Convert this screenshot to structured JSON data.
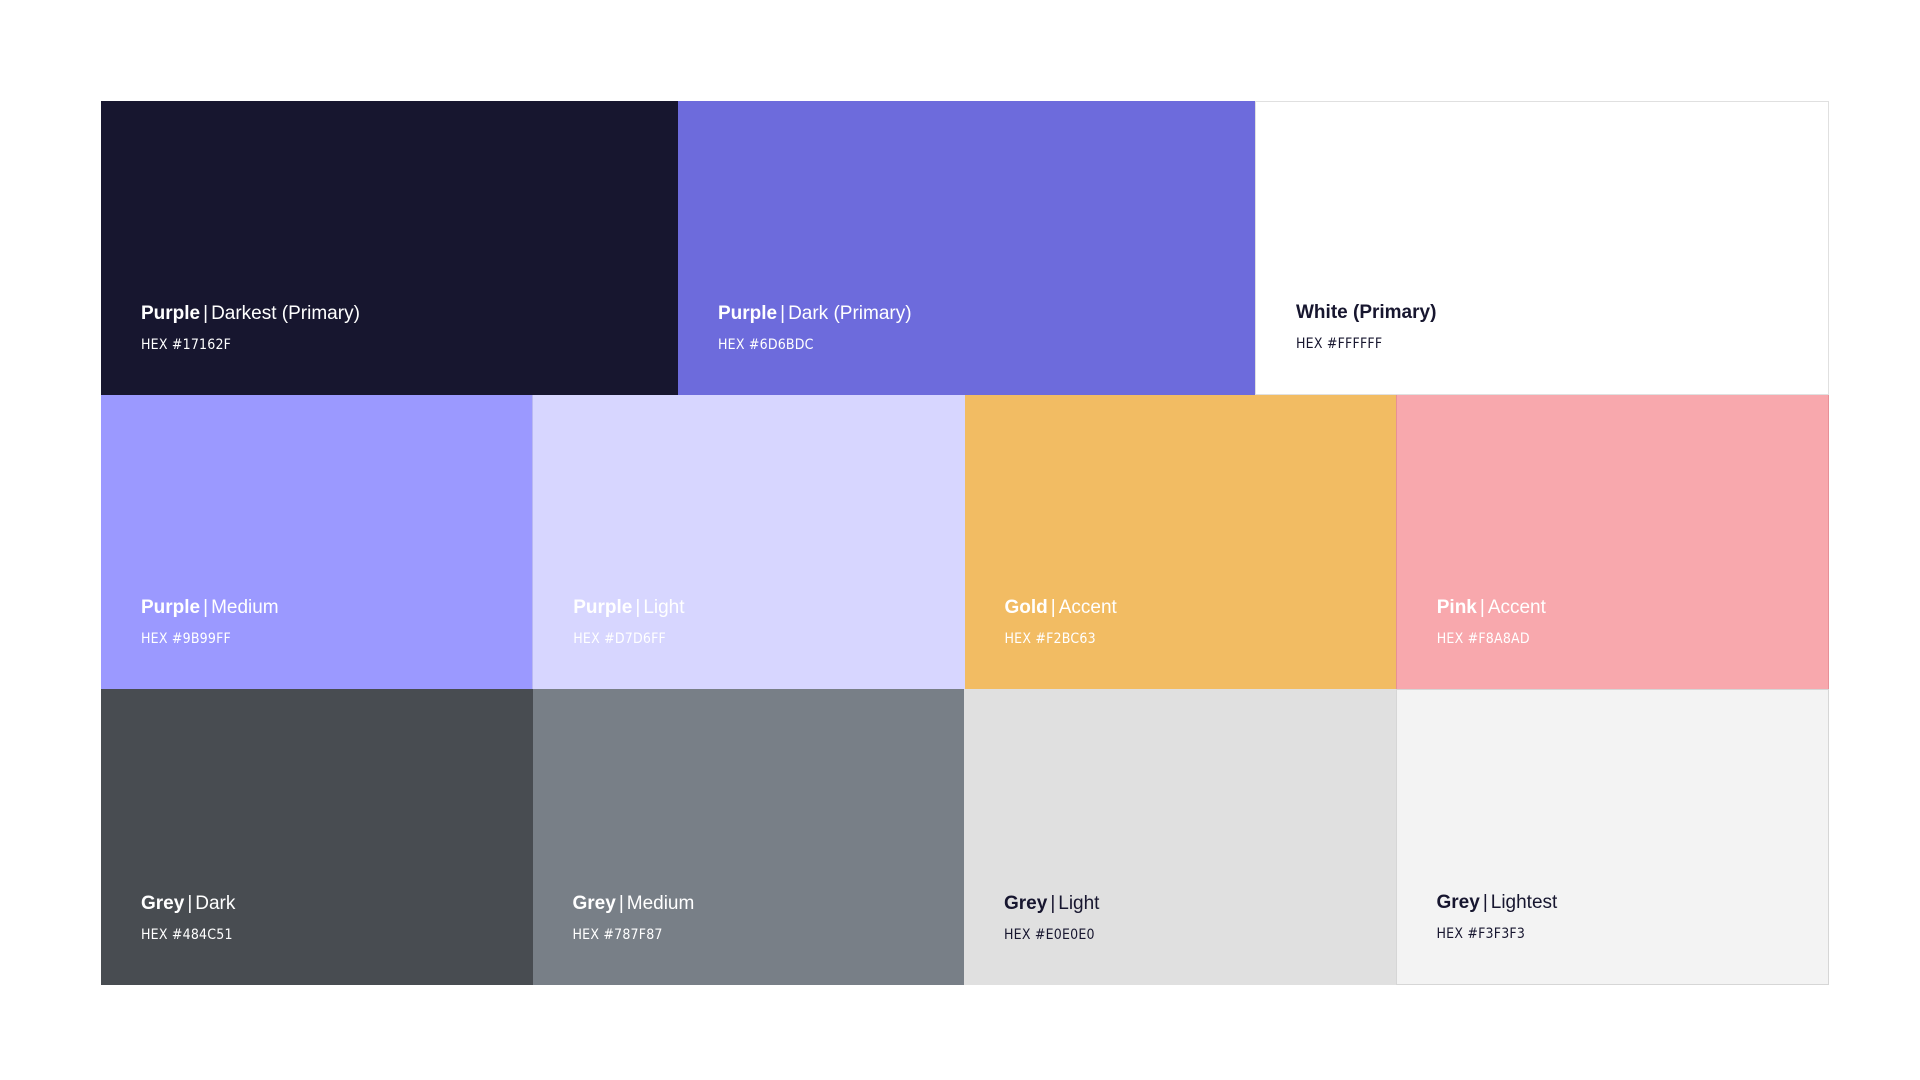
{
  "swatches": {
    "row1": [
      {
        "name": "Purple",
        "variant": "Darkest (Primary)",
        "hex_label": "HEX #17162F",
        "color": "#17162F"
      },
      {
        "name": "Purple",
        "variant": "Dark (Primary)",
        "hex_label": "HEX #6D6BDC",
        "color": "#6D6BDC"
      },
      {
        "name": "White (Primary)",
        "variant": "",
        "hex_label": "HEX #FFFFFF",
        "color": "#FFFFFF"
      }
    ],
    "row2": [
      {
        "name": "Purple",
        "variant": "Medium",
        "hex_label": "HEX #9B99FF",
        "color": "#9B99FF"
      },
      {
        "name": "Purple",
        "variant": "Light",
        "hex_label": "HEX #D7D6FF",
        "color": "#D7D6FF"
      },
      {
        "name": "Gold",
        "variant": "Accent",
        "hex_label": "HEX #F2BC63",
        "color": "#F2BC63"
      },
      {
        "name": "Pink",
        "variant": "Accent",
        "hex_label": "HEX #F8A8AD",
        "color": "#F8A8AD"
      }
    ],
    "row3": [
      {
        "name": "Grey",
        "variant": "Dark",
        "hex_label": "HEX #484C51",
        "color": "#484C51"
      },
      {
        "name": "Grey",
        "variant": "Medium",
        "hex_label": "HEX #787F87",
        "color": "#787F87"
      },
      {
        "name": "Grey",
        "variant": "Light",
        "hex_label": "HEX #E0E0E0",
        "color": "#E0E0E0"
      },
      {
        "name": "Grey",
        "variant": "Lightest",
        "hex_label": "HEX #F3F3F3",
        "color": "#F3F3F3"
      }
    ]
  },
  "separator": "|"
}
